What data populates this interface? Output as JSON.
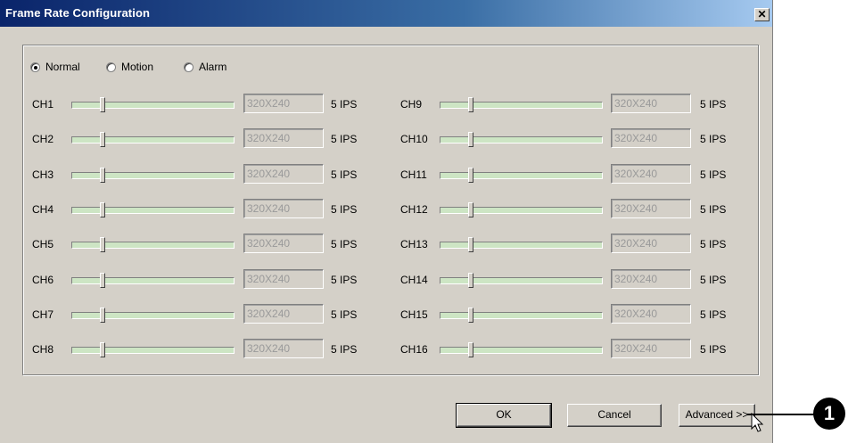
{
  "dialog": {
    "title": "Frame Rate Configuration",
    "close_glyph": "✕"
  },
  "modes": [
    {
      "label": "Normal",
      "selected": true
    },
    {
      "label": "Motion",
      "selected": false
    },
    {
      "label": "Alarm",
      "selected": false
    }
  ],
  "channels": [
    {
      "name": "CH1",
      "resolution": "320X240",
      "rate": "5 IPS"
    },
    {
      "name": "CH2",
      "resolution": "320X240",
      "rate": "5 IPS"
    },
    {
      "name": "CH3",
      "resolution": "320X240",
      "rate": "5 IPS"
    },
    {
      "name": "CH4",
      "resolution": "320X240",
      "rate": "5 IPS"
    },
    {
      "name": "CH5",
      "resolution": "320X240",
      "rate": "5 IPS"
    },
    {
      "name": "CH6",
      "resolution": "320X240",
      "rate": "5 IPS"
    },
    {
      "name": "CH7",
      "resolution": "320X240",
      "rate": "5 IPS"
    },
    {
      "name": "CH8",
      "resolution": "320X240",
      "rate": "5 IPS"
    },
    {
      "name": "CH9",
      "resolution": "320X240",
      "rate": "5 IPS"
    },
    {
      "name": "CH10",
      "resolution": "320X240",
      "rate": "5 IPS"
    },
    {
      "name": "CH11",
      "resolution": "320X240",
      "rate": "5 IPS"
    },
    {
      "name": "CH12",
      "resolution": "320X240",
      "rate": "5 IPS"
    },
    {
      "name": "CH13",
      "resolution": "320X240",
      "rate": "5 IPS"
    },
    {
      "name": "CH14",
      "resolution": "320X240",
      "rate": "5 IPS"
    },
    {
      "name": "CH15",
      "resolution": "320X240",
      "rate": "5 IPS"
    },
    {
      "name": "CH16",
      "resolution": "320X240",
      "rate": "5 IPS"
    }
  ],
  "slider_level_fraction": 0.2,
  "buttons": {
    "ok": "OK",
    "cancel": "Cancel",
    "advanced": "Advanced >>"
  },
  "callout": {
    "number": "1"
  },
  "colors": {
    "title_bar": "#0a246a",
    "slider_track": "#cde5c4",
    "dialog_face": "#d4d0c8"
  }
}
